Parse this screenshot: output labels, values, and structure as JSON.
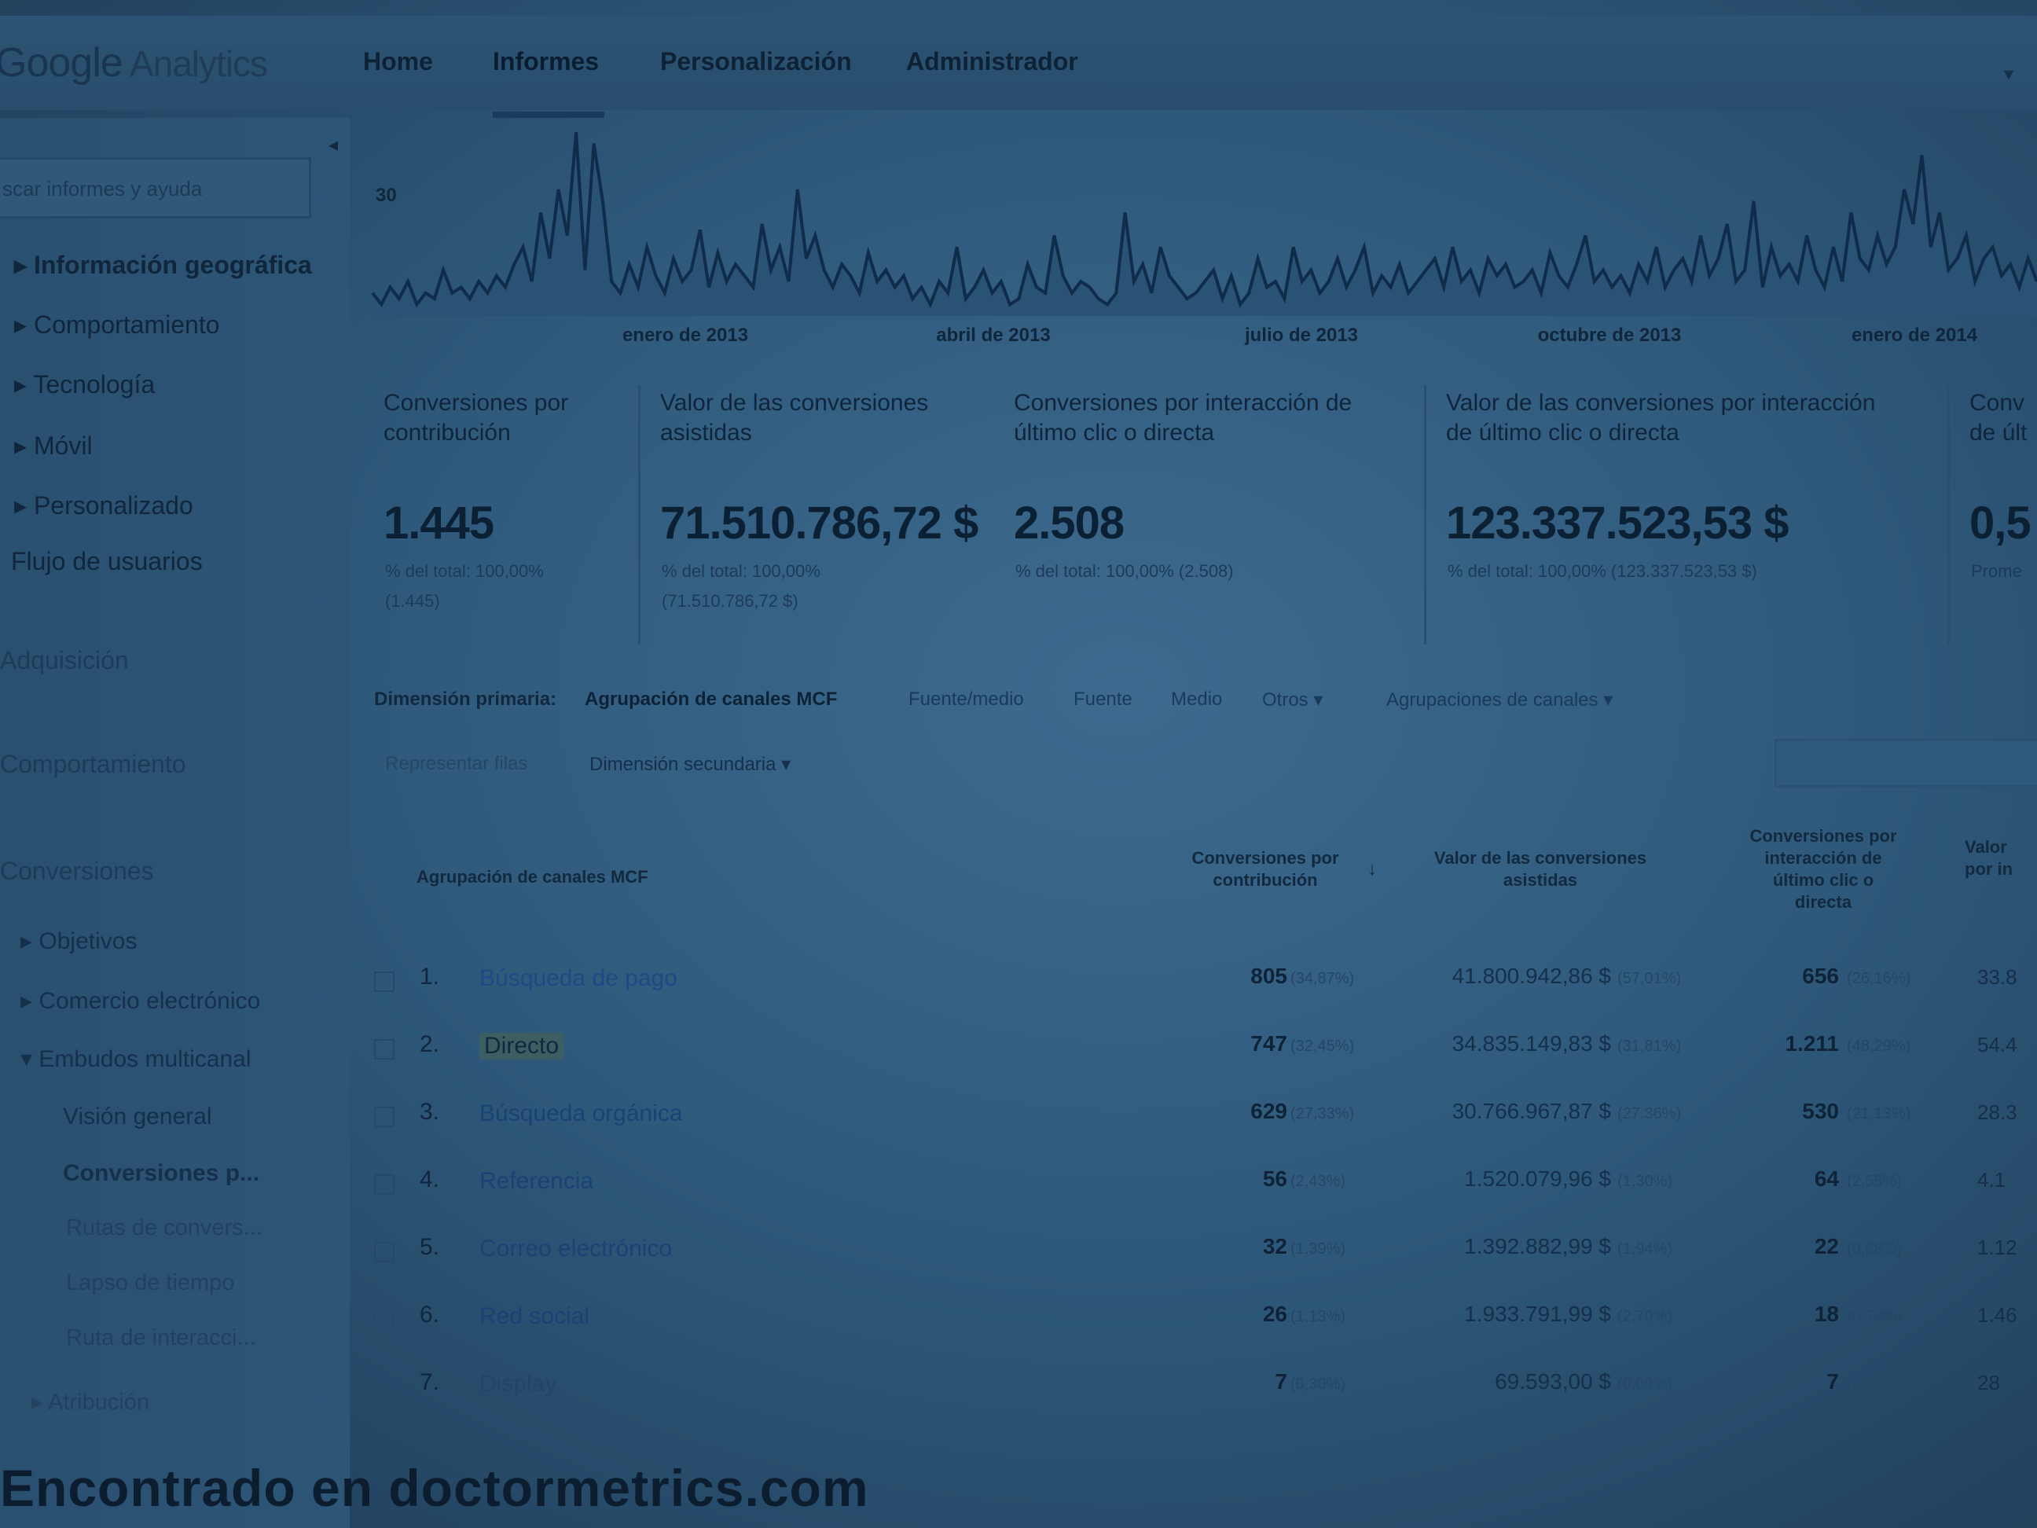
{
  "app": {
    "logo_google": "Google",
    "logo_analytics": " Analytics"
  },
  "nav": {
    "home": "Home",
    "reports": "Informes",
    "customize": "Personalización",
    "admin": "Administrador"
  },
  "sidebar": {
    "search_placeholder": "scar informes y ayuda",
    "items": [
      "▸ Información geográfica",
      "▸ Comportamiento",
      "▸ Tecnología",
      "▸ Móvil",
      "▸ Personalizado",
      "Flujo de usuarios",
      "Adquisición",
      "Comportamiento",
      "Conversiones",
      "▸ Objetivos",
      "▸ Comercio electrónico",
      "▾ Embudos multicanal",
      "Visión general",
      "Conversiones p...",
      "Rutas de convers...",
      "Lapso de tiempo",
      "Ruta de interacci...",
      "▸ Atribución"
    ]
  },
  "chart_data": {
    "type": "line",
    "ymax_label": "30",
    "x_labels": [
      "enero de 2013",
      "abril de 2013",
      "julio de 2013",
      "octubre de 2013",
      "enero de 2014"
    ],
    "values": [
      4,
      2,
      5,
      3,
      6,
      2,
      4,
      3,
      8,
      4,
      5,
      3,
      6,
      4,
      7,
      5,
      9,
      12,
      6,
      18,
      10,
      22,
      14,
      32,
      8,
      30,
      20,
      6,
      4,
      9,
      5,
      12,
      7,
      4,
      10,
      6,
      8,
      15,
      5,
      11,
      6,
      9,
      7,
      5,
      16,
      8,
      12,
      6,
      22,
      10,
      14,
      8,
      5,
      9,
      7,
      4,
      11,
      6,
      8,
      5,
      7,
      3,
      5,
      2,
      6,
      4,
      12,
      3,
      5,
      8,
      4,
      6,
      2,
      3,
      9,
      5,
      4,
      14,
      7,
      4,
      6,
      5,
      3,
      2,
      4,
      18,
      6,
      9,
      4,
      12,
      7,
      5,
      3,
      4,
      6,
      8,
      3,
      7,
      2,
      4,
      10,
      5,
      6,
      3,
      12,
      6,
      8,
      4,
      6,
      10,
      5,
      8,
      12,
      4,
      7,
      5,
      9,
      4,
      6,
      8,
      10,
      5,
      12,
      6,
      8,
      4,
      10,
      7,
      9,
      5,
      6,
      8,
      4,
      11,
      7,
      5,
      9,
      14,
      6,
      8,
      5,
      7,
      4,
      9,
      6,
      12,
      5,
      8,
      10,
      6,
      14,
      7,
      10,
      16,
      6,
      8,
      20,
      5,
      12,
      7,
      9,
      6,
      14,
      8,
      5,
      12,
      6,
      18,
      10,
      8,
      14,
      9,
      12,
      22,
      16,
      28,
      12,
      18,
      8,
      10,
      14,
      6,
      10,
      12,
      7,
      9,
      5,
      10,
      6
    ],
    "ylim": [
      0,
      32
    ]
  },
  "metrics": [
    {
      "title_1": "Conversiones por",
      "title_2": "contribución",
      "value": "1.445",
      "sub_1": "% del total: 100,00%",
      "sub_2": "(1.445)"
    },
    {
      "title_1": "Valor de las conversiones",
      "title_2": "asistidas",
      "value": "71.510.786,72 $",
      "sub_1": "% del total: 100,00%",
      "sub_2": "(71.510.786,72 $)"
    },
    {
      "title_1": "Conversiones por interacción de",
      "title_2": "último clic o directa",
      "value": "2.508",
      "sub_1": "% del total: 100,00% (2.508)",
      "sub_2": ""
    },
    {
      "title_1": "Valor de las conversiones por interacción",
      "title_2": "de último clic o directa",
      "value": "123.337.523,53 $",
      "sub_1": "% del total: 100,00% (123.337.523,53 $)",
      "sub_2": ""
    },
    {
      "title_1": "Conv",
      "title_2": "de últ",
      "value": "0,5",
      "sub_1": "Prome",
      "sub_2": ""
    }
  ],
  "dimension_bar": {
    "label": "Dimensión primaria:",
    "active": "Agrupación de canales MCF",
    "links": [
      "Fuente/medio",
      "Fuente",
      "Medio",
      "Otros ▾",
      "Agrupaciones de canales ▾"
    ]
  },
  "toolbar": {
    "plot_rows": "Representar filas",
    "secondary": "Dimensión secundaria ▾"
  },
  "table": {
    "headers": {
      "channel": "Agrupación de canales MCF",
      "contrib_1": "Conversiones por",
      "contrib_2": "contribución",
      "assisted_1": "Valor de las conversiones",
      "assisted_2": "asistidas",
      "last_1": "Conversiones por",
      "last_2": "interacción de",
      "last_3": "último clic o",
      "last_4": "directa",
      "edge_1": "Valor",
      "edge_2": "por in"
    },
    "rows": [
      {
        "n": "1.",
        "name": "Búsqueda de pago",
        "c": "805",
        "cp": "(34,87%)",
        "v": "41.800.942,86 $",
        "vp": "(57,01%)",
        "l": "656",
        "lp": "(26,16%)",
        "e": "33.8"
      },
      {
        "n": "2.",
        "name": "Directo",
        "c": "747",
        "cp": "(32,45%)",
        "v": "34.835.149,83 $",
        "vp": "(31,81%)",
        "l": "1.211",
        "lp": "(48,29%)",
        "e": "54.4"
      },
      {
        "n": "3.",
        "name": "Búsqueda orgánica",
        "c": "629",
        "cp": "(27,33%)",
        "v": "30.766.967,87 $",
        "vp": "(27,36%)",
        "l": "530",
        "lp": "(21,13%)",
        "e": "28.3"
      },
      {
        "n": "4.",
        "name": "Referencia",
        "c": "56",
        "cp": "(2,43%)",
        "v": "1.520.079,96 $",
        "vp": "(1,30%)",
        "l": "64",
        "lp": "(2,55%)",
        "e": "4.1"
      },
      {
        "n": "5.",
        "name": "Correo electrónico",
        "c": "32",
        "cp": "(1,39%)",
        "v": "1.392.882,99 $",
        "vp": "(1,94%)",
        "l": "22",
        "lp": "(0,88%)",
        "e": "1.12"
      },
      {
        "n": "6.",
        "name": "Red social",
        "c": "26",
        "cp": "(1,13%)",
        "v": "1.933.791,99 $",
        "vp": "(2,70%)",
        "l": "18",
        "lp": "(0,72%)",
        "e": "1.46"
      },
      {
        "n": "7.",
        "name": "Display",
        "c": "7",
        "cp": "(0,30%)",
        "v": "69.593,00 $",
        "vp": "(0,09%)",
        "l": "7",
        "lp": "(0,28%)",
        "e": "28"
      }
    ]
  },
  "watermark": "Encontrado en doctormetrics.com"
}
